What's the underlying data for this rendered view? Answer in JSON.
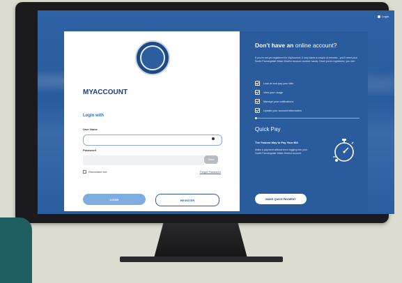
{
  "topbar": {
    "login_link": "Login"
  },
  "login": {
    "title": "MYACCOUNT",
    "subtitle": "Login with",
    "username_label": "User Name",
    "password_label": "Password",
    "show_label": "Show",
    "remember_label": "Remember me",
    "forgot_label": "Forgot Password",
    "login_button": "LOGIN",
    "register_button": "REGISTER"
  },
  "signup": {
    "title_bold": "Don't have an",
    "title_rest": "online account?",
    "description": "If you're not yet registered for MyAccount, it only takes a couple of minutes - you'll need your South Farmingdale Water District account number handy. Once you're registered, you can:",
    "features": [
      "Look at and pay your bills",
      "View your usage",
      "Manage your notifications",
      "Update your account information"
    ]
  },
  "quick_pay": {
    "title": "Quick Pay",
    "subtitle": "The Fastest Way to Pay Your Bill",
    "description": "Make a payment without even logging into your South Farmingdale Water District account",
    "button": "MAKE QUICK PAYMENT"
  },
  "colors": {
    "primary": "#2a5b9c",
    "login_button": "#7eaee0",
    "title": "#1e3e78"
  }
}
